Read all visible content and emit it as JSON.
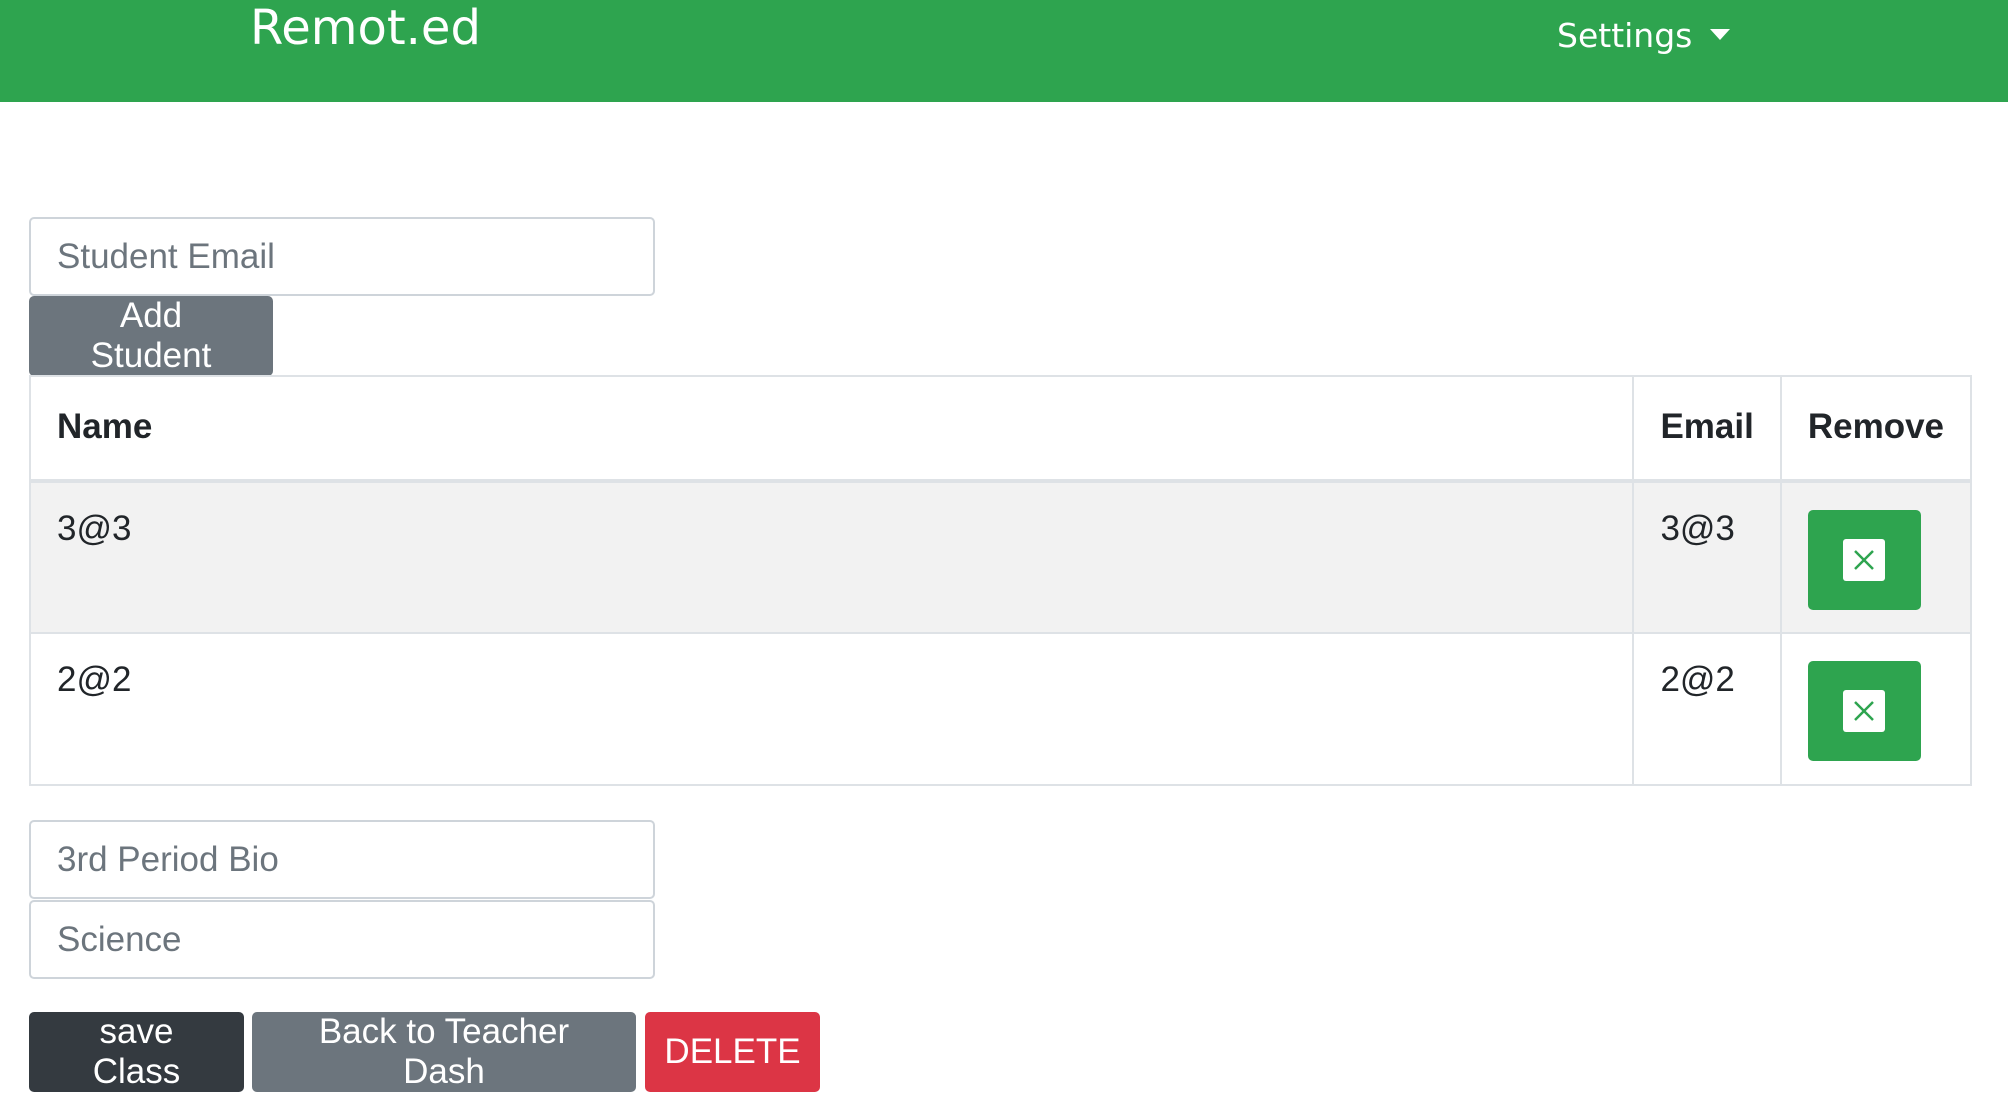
{
  "navbar": {
    "brand": "Remot.ed",
    "settings_label": "Settings"
  },
  "add_student": {
    "email_placeholder": "Student Email",
    "button_label": "Add Student"
  },
  "table": {
    "headers": [
      "Name",
      "Email",
      "Remove"
    ],
    "rows": [
      {
        "name": "3@3",
        "email": "3@3",
        "remove_icon": "close-icon"
      },
      {
        "name": "2@2",
        "email": "2@2",
        "remove_icon": "close-icon"
      }
    ]
  },
  "class_form": {
    "class_name_placeholder": "3rd Period Bio",
    "subject_placeholder": "Science"
  },
  "actions": {
    "save_label": "save Class",
    "back_label": "Back to Teacher Dash",
    "delete_label": "DELETE"
  },
  "colors": {
    "navbar": "#2ea44f",
    "remove_button": "#2ea44f",
    "secondary": "#6c757d",
    "dark": "#343a40",
    "danger": "#dc3545"
  }
}
